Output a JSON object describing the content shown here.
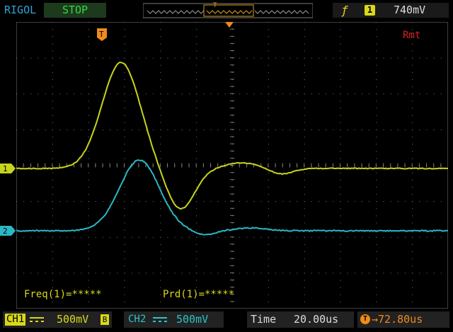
{
  "header": {
    "brand": "RIGOL",
    "run_status": "STOP",
    "memory_marker": "T",
    "trigger_source": "1",
    "trigger_level": "740mV",
    "trigger_edge_icon": "rising-edge-icon"
  },
  "screen": {
    "remote_label": "Rmt",
    "ch1_marker": "1",
    "ch2_marker": "2",
    "trigger_marker": "T"
  },
  "measurements": {
    "freq": "Freq(1)=*****",
    "prd": "Prd(1)=*****"
  },
  "footer": {
    "ch1_label": "CH1",
    "ch1_coupling": "DC",
    "ch1_scale": "500mV",
    "ch1_bw": "B",
    "ch2_label": "CH2",
    "ch2_coupling": "DC",
    "ch2_scale": "500mV",
    "time_label": "Time",
    "time_value": "20.00us",
    "offset_value": "72.80us"
  },
  "colors": {
    "ch1": "#c8d41c",
    "ch2": "#2bb7c4",
    "trigger": "#f08a1a",
    "grid": "#7a7a7a"
  }
}
